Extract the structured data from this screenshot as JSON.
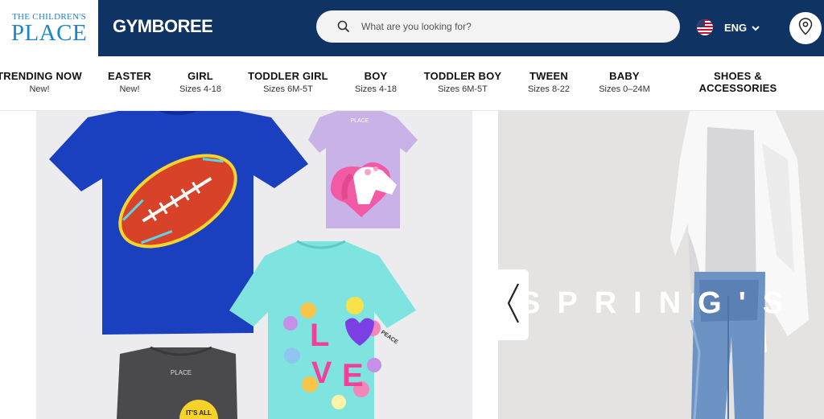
{
  "header": {
    "tcp_logo_small": "THE CHILDREN'S",
    "tcp_logo_big": "PLACE",
    "gym_logo": "GYMBOREE",
    "search_placeholder": "What are you looking for?",
    "language": "ENG",
    "icons": {
      "search": "search-icon",
      "flag": "us-flag-icon",
      "chevron": "chevron-down-icon",
      "store": "location-pin-icon"
    }
  },
  "nav": {
    "items": [
      {
        "title": "TRENDING NOW",
        "sub": "New!"
      },
      {
        "title": "EASTER",
        "sub": "New!"
      },
      {
        "title": "GIRL",
        "sub": "Sizes 4-18"
      },
      {
        "title": "TODDLER GIRL",
        "sub": "Sizes 6M-5T"
      },
      {
        "title": "BOY",
        "sub": "Sizes 4-18"
      },
      {
        "title": "TODDLER BOY",
        "sub": "Sizes 6M-5T"
      },
      {
        "title": "TWEEN",
        "sub": "Sizes 8-22"
      },
      {
        "title": "BABY",
        "sub": "Sizes 0–24M"
      },
      {
        "title": "SHOES &",
        "sub": "ACCESSORIES"
      }
    ]
  },
  "carousel": {
    "slide_text": "SPRING'S IT",
    "shirt_tags": [
      "PLACE",
      "PLACE",
      "PLACE"
    ],
    "love_letters": [
      "L",
      "V",
      "E"
    ],
    "peace_text": "PEACE",
    "badge_text": "IT'S ALL",
    "colors": {
      "blue_shirt": "#1a3fbf",
      "lilac_shirt": "#c9b2e8",
      "aqua_shirt": "#7fe4e0",
      "grey_shirt": "#4a4a4e"
    },
    "icons": {
      "prev": "chevron-left-icon"
    }
  }
}
